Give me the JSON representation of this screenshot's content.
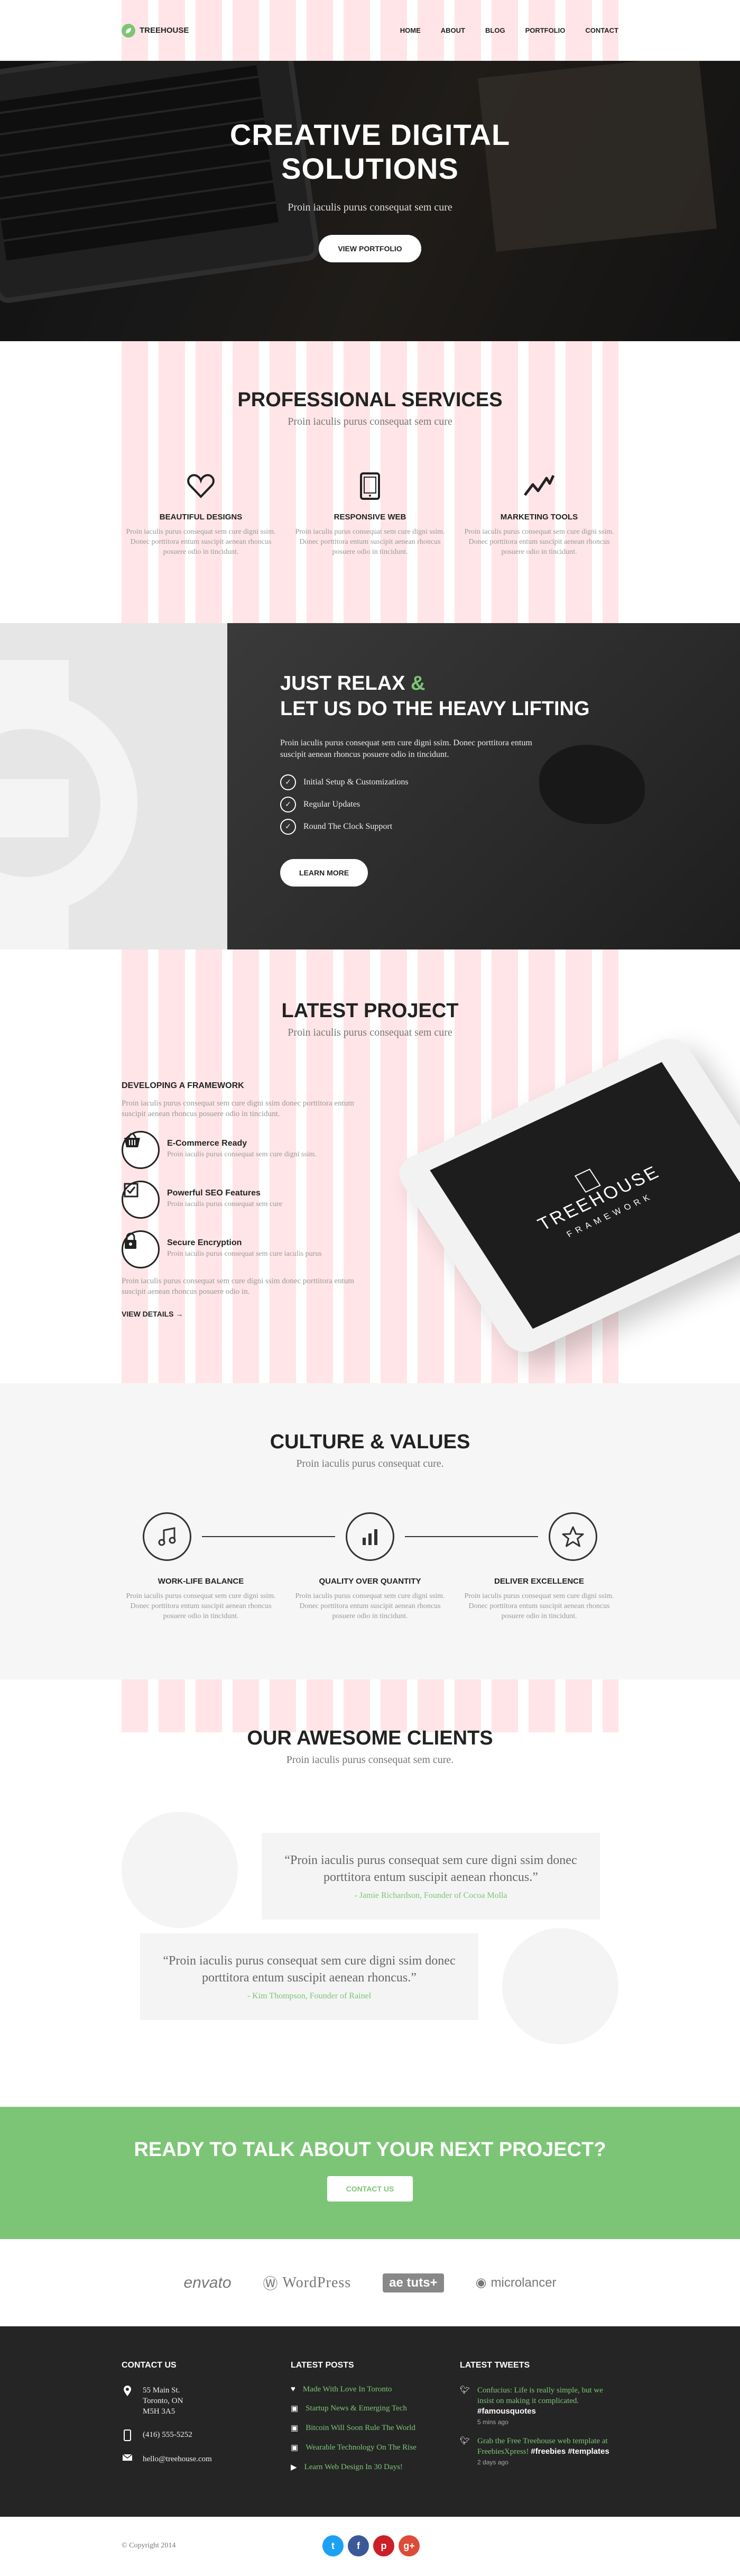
{
  "brand": {
    "name": "TREEHOUSE",
    "accent": "#7cc576",
    "dark": "#252525"
  },
  "nav": [
    "HOME",
    "ABOUT",
    "BLOG",
    "PORTFOLIO",
    "CONTACT"
  ],
  "hero": {
    "title_line1": "CREATIVE DIGITAL",
    "title_line2": "SOLUTIONS",
    "subtitle": "Proin iaculis purus consequat sem cure",
    "button": "VIEW PORTFOLIO"
  },
  "services": {
    "title": "PROFESSIONAL SERVICES",
    "subtitle": "Proin iaculis purus consequat sem cure",
    "items": [
      {
        "icon": "heart-icon",
        "title": "BEAUTIFUL DESIGNS",
        "text": "Proin iaculis purus consequat sem cure digni ssim. Donec porttitora entum suscipit aenean rhoncus posuere odio in tincidunt."
      },
      {
        "icon": "tablet-icon",
        "title": "RESPONSIVE WEB",
        "text": "Proin iaculis purus consequat sem cure digni ssim. Donec porttitora entum suscipit aenean rhoncus posuere odio in tincidunt."
      },
      {
        "icon": "chart-line-icon",
        "title": "MARKETING TOOLS",
        "text": "Proin iaculis purus consequat sem cure digni ssim. Donec porttitora entum suscipit aenean rhoncus posuere odio in tincidunt."
      }
    ]
  },
  "relax": {
    "title_part1": "JUST RELAX",
    "amp": "&",
    "title_part2": "LET US DO THE HEAVY LIFTING",
    "text": "Proin iaculis purus consequat sem cure digni ssim. Donec porttitora entum suscipit aenean rhoncus posuere odio in tincidunt.",
    "list": [
      "Initial Setup & Customizations",
      "Regular Updates",
      "Round The Clock Support"
    ],
    "button": "LEARN MORE"
  },
  "project": {
    "title": "LATEST PROJECT",
    "subtitle": "Proin iaculis purus consequat sem cure",
    "heading": "DEVELOPING A FRAMEWORK",
    "intro": "Proin iaculis purus consequat sem cure digni ssim donec porttitora entum suscipit aenean rhoncus posuere odio in tincidunt.",
    "features": [
      {
        "icon": "basket-icon",
        "title": "E-Commerce Ready",
        "text": "Proin iaculis purus consequat sem cure digni ssim."
      },
      {
        "icon": "checkbox-icon",
        "title": "Powerful SEO Features",
        "text": "Proin iaculis purus consequat sem cure"
      },
      {
        "icon": "lock-icon",
        "title": "Secure Encryption",
        "text": "Proin iaculis purus consequat sem cure iaculis purus"
      }
    ],
    "outro": "Proin iaculis purus consequat sem cure digni ssim donec porttitora entum suscipit aenean rhoncus posuere odio in.",
    "link": "VIEW DETAILS",
    "device_title": "TREEHOUSE",
    "device_subtitle": "FRAMEWORK"
  },
  "culture": {
    "title": "CULTURE & VALUES",
    "subtitle": "Proin iaculis purus consequat cure.",
    "items": [
      {
        "icon": "music-note-icon",
        "title": "WORK-LIFE BALANCE",
        "text": "Proin iaculis purus consequat sem cure digni ssim. Donec porttitora entum suscipit aenean rhoncus posuere odio in tincidunt."
      },
      {
        "icon": "bar-chart-icon",
        "title": "QUALITY OVER QUANTITY",
        "text": "Proin iaculis purus consequat sem cure digni ssim. Donec porttitora entum suscipit aenean rhoncus posuere odio in tincidunt."
      },
      {
        "icon": "star-icon",
        "title": "DELIVER EXCELLENCE",
        "text": "Proin iaculis purus consequat sem cure digni ssim. Donec porttitora entum suscipit aenean rhoncus posuere odio in tincidunt."
      }
    ]
  },
  "clients": {
    "title": "OUR AWESOME CLIENTS",
    "subtitle": "Proin iaculis purus consequat sem cure.",
    "testimonials": [
      {
        "quote": "Proin iaculis purus consequat sem cure digni ssim donec porttitora entum suscipit aenean rhoncus.",
        "author": "- Jamie Richardson, Founder of Cocoa Molla"
      },
      {
        "quote": "Proin iaculis purus consequat sem cure digni ssim donec porttitora entum suscipit aenean rhoncus.",
        "author": "- Kim Thompson, Founder of Rainel"
      }
    ]
  },
  "cta": {
    "title": "READY TO TALK ABOUT YOUR NEXT PROJECT?",
    "button": "CONTACT US"
  },
  "partners": [
    "envato",
    "WordPress",
    "ae",
    "tuts+",
    "microlancer"
  ],
  "footer": {
    "contact": {
      "heading": "CONTACT US",
      "address": [
        "55 Main St.",
        "Toronto, ON",
        "M5H 3A5"
      ],
      "phone": "(416) 555-5252",
      "email": "hello@treehouse.com"
    },
    "posts": {
      "heading": "LATEST POSTS",
      "items": [
        "Made With Love In Toronto",
        "Startup News & Emerging Tech",
        "Bitcoin Will Soon Rule The World",
        "Wearable Technology On The Rise",
        "Learn Web Design In 30 Days!"
      ]
    },
    "tweets": {
      "heading": "LATEST TWEETS",
      "items": [
        {
          "text": "Confucius: Life is really simple, but we insist on making it complicated.",
          "tag": "#famousquotes",
          "ago": "5 mins ago"
        },
        {
          "text": "Grab the Free Treehouse web template at FreebiesXpress!",
          "tag": "#freebies #templates",
          "ago": "2 days ago"
        }
      ]
    }
  },
  "bottom": {
    "copyright": "© Copyright 2014",
    "socials": [
      {
        "name": "twitter",
        "glyph": "t",
        "color": "#1da1f2"
      },
      {
        "name": "facebook",
        "glyph": "f",
        "color": "#3b5998"
      },
      {
        "name": "pinterest",
        "glyph": "p",
        "color": "#cb2027"
      },
      {
        "name": "google-plus",
        "glyph": "g+",
        "color": "#dd4b39"
      }
    ]
  }
}
